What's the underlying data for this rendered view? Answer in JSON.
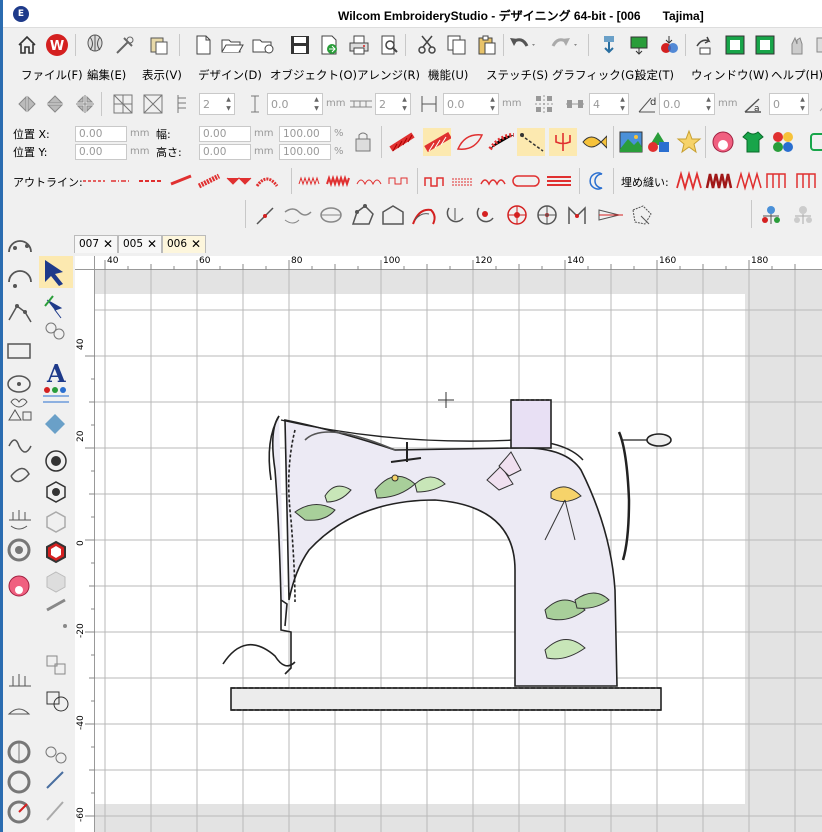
{
  "window": {
    "title": "Wilcom EmbroideryStudio - デザイニング 64-bit - [006",
    "title_suffix": "Tajima]"
  },
  "menu": [
    {
      "id": "file",
      "label": "ファイル(F)"
    },
    {
      "id": "edit",
      "label": "編集(E)"
    },
    {
      "id": "view",
      "label": "表示(V)"
    },
    {
      "id": "design",
      "label": "デザイン(D)"
    },
    {
      "id": "object",
      "label": "オブジェクト(O)"
    },
    {
      "id": "arrange",
      "label": "アレンジ(R)"
    },
    {
      "id": "function",
      "label": "機能(U)"
    },
    {
      "id": "stitch",
      "label": "ステッチ(S)"
    },
    {
      "id": "graphic",
      "label": "グラフィック(G)"
    },
    {
      "id": "settings",
      "label": "設定(T)"
    },
    {
      "id": "window",
      "label": "ウィンドウ(W)"
    },
    {
      "id": "help",
      "label": "ヘルプ(H)"
    }
  ],
  "toolbar3": {
    "count1": "2",
    "spacing1": "0.0",
    "unit": "mm",
    "count2": "2",
    "spacing2": "0.0",
    "count3": "4",
    "spacing3": "0.0",
    "count4": "0"
  },
  "position": {
    "x_label": "位置 X:",
    "y_label": "位置 Y:",
    "x_value": "0.00",
    "y_value": "0.00",
    "width_label": "幅:",
    "height_label": "高さ:",
    "width_value": "0.00",
    "height_value": "0.00",
    "width_pct": "100.00",
    "height_pct": "100.00",
    "unit": "mm",
    "pct": "%"
  },
  "outline_label": "アウトライン:",
  "fill_label": "埋め縫い:",
  "tabs": [
    {
      "id": "007",
      "label": "007",
      "active": false
    },
    {
      "id": "005",
      "label": "005",
      "active": false
    },
    {
      "id": "006",
      "label": "006",
      "active": true
    }
  ],
  "ruler": {
    "h_ticks": [
      "40",
      "60",
      "80",
      "100",
      "120",
      "140",
      "160",
      "180"
    ],
    "v_ticks": [
      "40",
      "20",
      "0",
      "-20",
      "-40",
      "-60"
    ]
  },
  "colors": {
    "accent_red": "#e03030",
    "brand_red": "#d42020",
    "canvas_bg": "#e3e3e3",
    "hoop": "#ffffff",
    "grid": "#bdbdbd"
  }
}
